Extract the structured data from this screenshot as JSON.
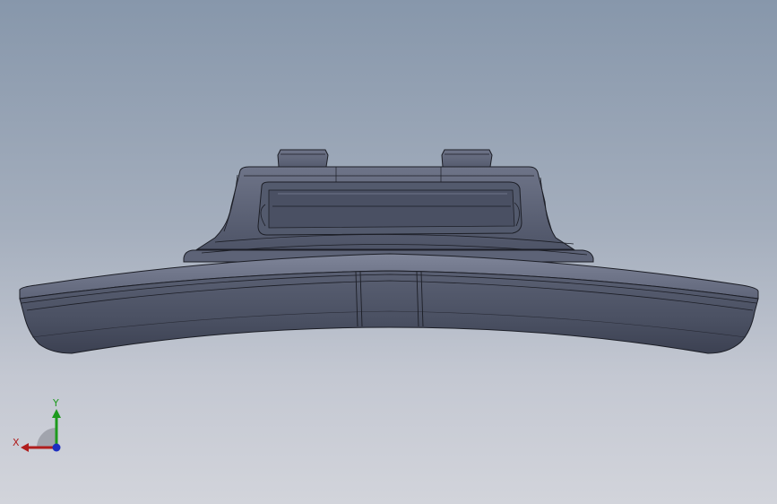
{
  "viewport": {
    "background_top": "#8797ab",
    "background_bottom": "#d2d4db"
  },
  "model": {
    "body_color": "#545a6c",
    "edge_color": "#1c1e26",
    "highlight_color": "#8a90a4"
  },
  "triad": {
    "x_label": "X",
    "y_label": "Y",
    "x_color": "#b01d1d",
    "y_color": "#1d9a1d",
    "z_color": "#1d2fc0"
  }
}
